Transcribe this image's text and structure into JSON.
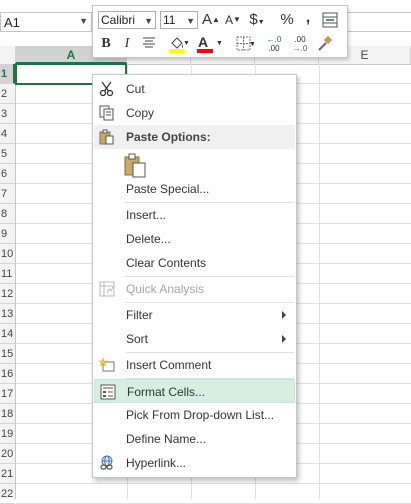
{
  "namebox": {
    "value": "A1"
  },
  "columns": [
    {
      "label": "A",
      "selected": true
    },
    {
      "label": "E",
      "selected": false
    }
  ],
  "rows": [
    "1",
    "2",
    "3",
    "4",
    "5",
    "6",
    "7",
    "8",
    "9",
    "10",
    "11",
    "12",
    "13",
    "14",
    "15",
    "16",
    "17",
    "18",
    "19",
    "20",
    "21",
    "22"
  ],
  "minitoolbar": {
    "font_name": "Calibri",
    "font_size": "11",
    "grow_font": "A",
    "shrink_font": "A",
    "currency": "$",
    "percent": "%",
    "comma": ",",
    "bold": "B",
    "italic": "I",
    "font_color_label": "A",
    "increase_decimal": "←.0 .00",
    "decrease_decimal": ".00 →.0"
  },
  "context_menu": {
    "items": [
      {
        "label": "Cut",
        "icon": "scissors-icon"
      },
      {
        "label": "Copy",
        "icon": "copy-icon"
      },
      {
        "label": "Paste Options:",
        "icon": "paste-icon",
        "header": true
      },
      {
        "label": "Paste Special..."
      },
      {
        "label": "Insert..."
      },
      {
        "label": "Delete..."
      },
      {
        "label": "Clear Contents"
      },
      {
        "label": "Quick Analysis",
        "icon": "quick-analysis-icon",
        "disabled": true
      },
      {
        "label": "Filter",
        "submenu": true
      },
      {
        "label": "Sort",
        "submenu": true
      },
      {
        "label": "Insert Comment",
        "icon": "insert-comment-icon"
      },
      {
        "label": "Format Cells...",
        "icon": "format-cells-icon",
        "highlighted": true
      },
      {
        "label": "Pick From Drop-down List..."
      },
      {
        "label": "Define Name..."
      },
      {
        "label": "Hyperlink...",
        "icon": "hyperlink-icon"
      }
    ]
  },
  "colors": {
    "excel_green": "#217346",
    "highlight": "#d6efe0",
    "font_color_bar": "#ff0000",
    "fill_color_bar": "#ffff00"
  }
}
